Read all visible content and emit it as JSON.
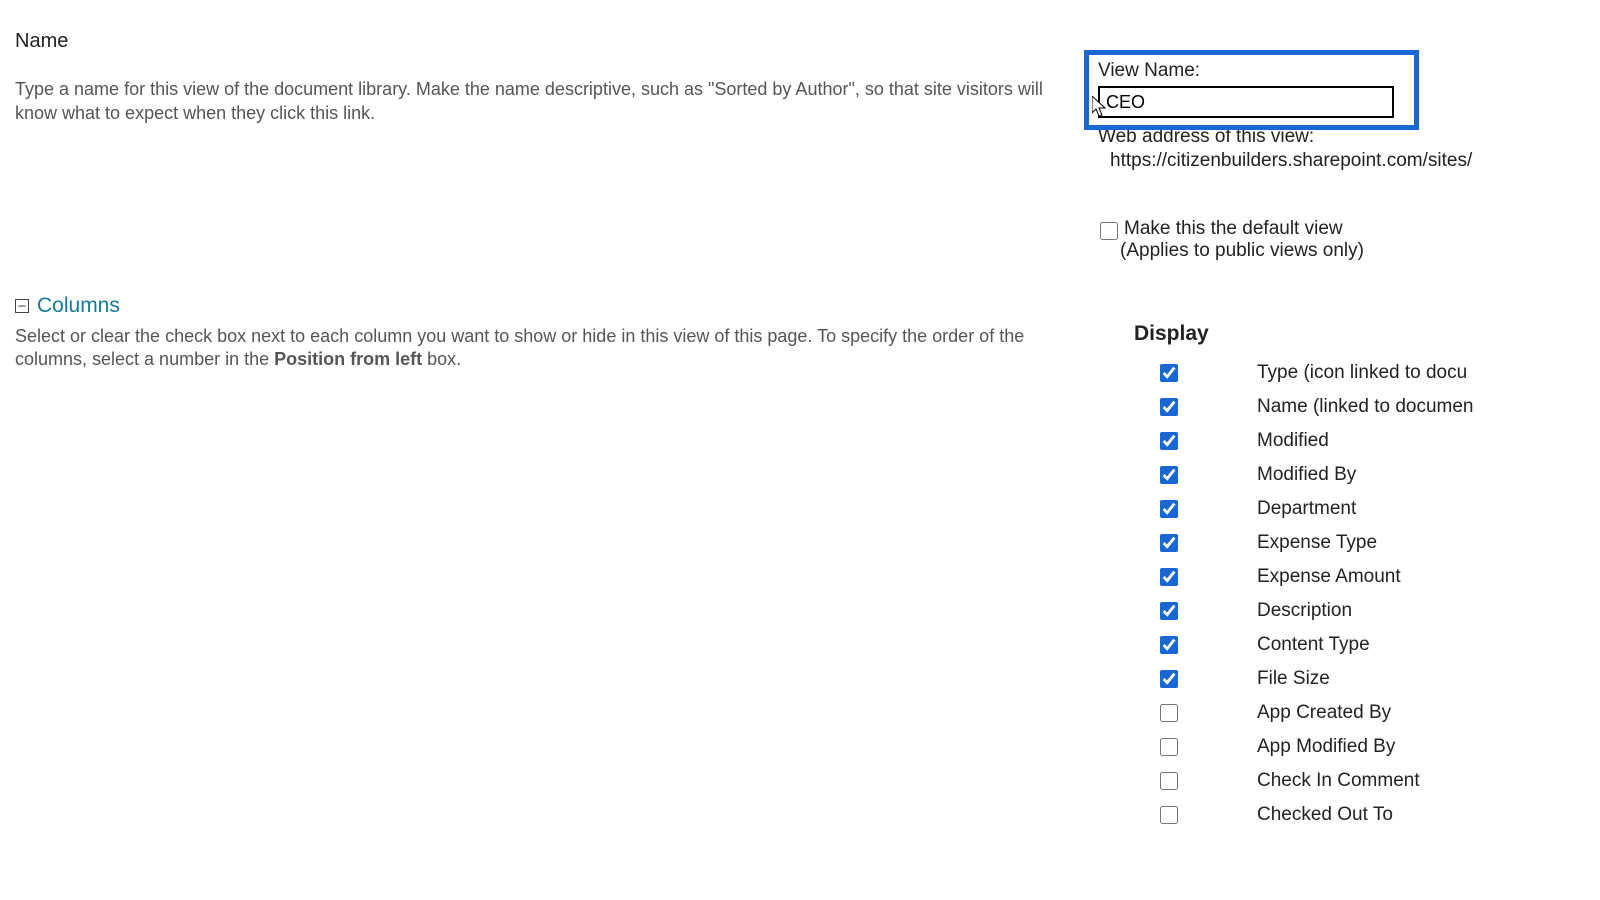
{
  "name_section": {
    "title": "Name",
    "description": "Type a name for this view of the document library. Make the name descriptive, such as \"Sorted by Author\", so that site visitors will know what to expect when they click this link."
  },
  "view_name": {
    "label": "View Name:",
    "value": "CEO"
  },
  "web_address": {
    "label": "Web address of this view:",
    "url": "https://citizenbuilders.sharepoint.com/sites/"
  },
  "default_view": {
    "checkbox_label": "Make this the default view",
    "note": "(Applies to public views only)",
    "checked": false
  },
  "columns_section": {
    "title": "Columns",
    "description_pre": "Select or clear the check box next to each column you want to show or hide in this view of this page. To specify the order of the columns, select a number in the ",
    "description_bold": "Position from left",
    "description_post": " box."
  },
  "display_block": {
    "title": "Display",
    "columns": [
      {
        "label": "Type (icon linked to docu",
        "checked": true
      },
      {
        "label": "Name (linked to documen",
        "checked": true
      },
      {
        "label": "Modified",
        "checked": true
      },
      {
        "label": "Modified By",
        "checked": true
      },
      {
        "label": "Department",
        "checked": true
      },
      {
        "label": "Expense Type",
        "checked": true
      },
      {
        "label": "Expense Amount",
        "checked": true
      },
      {
        "label": "Description",
        "checked": true
      },
      {
        "label": "Content Type",
        "checked": true
      },
      {
        "label": "File Size",
        "checked": true
      },
      {
        "label": "App Created By",
        "checked": false
      },
      {
        "label": "App Modified By",
        "checked": false
      },
      {
        "label": "Check In Comment",
        "checked": false
      },
      {
        "label": "Checked Out To",
        "checked": false
      }
    ]
  },
  "icons": {
    "toggle": "⊟"
  }
}
